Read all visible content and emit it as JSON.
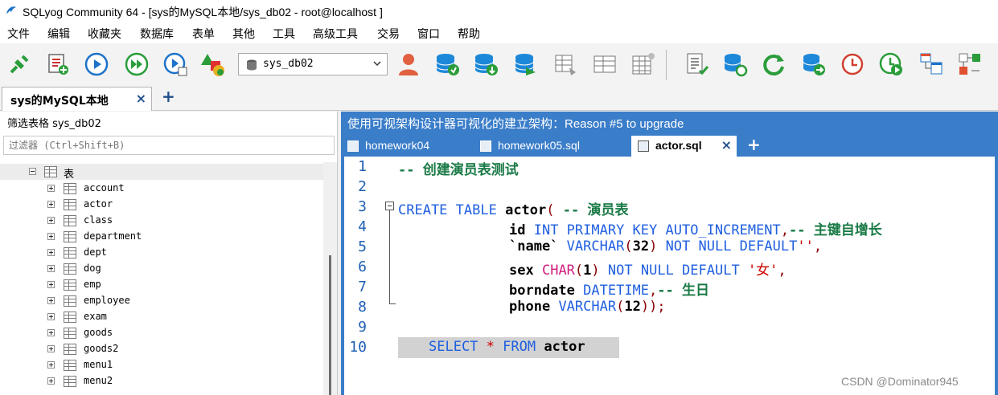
{
  "window": {
    "title": "SQLyog Community 64 - [sys的MySQL本地/sys_db02 - root@localhost ]"
  },
  "menu": [
    "文件",
    "编辑",
    "收藏夹",
    "数据库",
    "表单",
    "其他",
    "工具",
    "高级工具",
    "交易",
    "窗口",
    "帮助"
  ],
  "toolbar": {
    "database_select": "sys_db02"
  },
  "connection_tabs": [
    {
      "label": "sys的MySQL本地",
      "close": "×"
    }
  ],
  "add_tab": "+",
  "object_browser": {
    "filter_label": "筛选表格 sys_db02",
    "filter_placeholder": "过滤器 (Ctrl+Shift+B)",
    "root_label": "表",
    "tables": [
      "account",
      "actor",
      "class",
      "department",
      "dept",
      "dog",
      "emp",
      "employee",
      "exam",
      "goods",
      "goods2",
      "menu1",
      "menu2"
    ]
  },
  "editor_header": "使用可视架构设计器可视化的建立架构：Reason #5 to upgrade",
  "query_tabs": [
    {
      "label": "homework04",
      "active": false
    },
    {
      "label": "homework05.sql",
      "active": false
    },
    {
      "label": "actor.sql",
      "active": true,
      "close": "×"
    }
  ],
  "line_numbers": [
    "1",
    "2",
    "3",
    "4",
    "5",
    "6",
    "7",
    "8",
    "9",
    "10"
  ],
  "code": {
    "l1": "-- 创建演员表测试",
    "l3_kw": "CREATE TABLE",
    "l3_ident": "actor",
    "l3_paren": "(",
    "l3_cmt": "-- 演员表",
    "l4_ident": "id",
    "l4_kw": "INT PRIMARY KEY AUTO_INCREMENT",
    "l4_comma": ",",
    "l4_cmt": "-- 主键自增长",
    "l5_ident": "`name`",
    "l5_kw": "VARCHAR",
    "l5_p1": "(",
    "l5_num": "32",
    "l5_p2": ")",
    "l5_kw2": "NOT NULL DEFAULT",
    "l5_str": "''",
    "l5_comma": ",",
    "l6_ident": "sex",
    "l6_kw": "CHAR",
    "l6_p1": "(",
    "l6_num": "1",
    "l6_p2": ")",
    "l6_kw2": "NOT NULL DEFAULT",
    "l6_str": "'女'",
    "l6_comma": ",",
    "l7_ident": "borndate",
    "l7_kw": "DATETIME",
    "l7_comma": ",",
    "l7_cmt": "-- 生日",
    "l8_ident": "phone",
    "l8_kw": "VARCHAR",
    "l8_p1": "(",
    "l8_num": "12",
    "l8_p2": "));",
    "l10_kw": "SELECT",
    "l10_star": "*",
    "l10_kw2": "FROM",
    "l10_ident": "actor"
  },
  "watermark": "CSDN @Dominator945",
  "colors": {
    "accent": "#3a7dc9",
    "keyword": "#1f5fe0",
    "comment": "#1a7a46",
    "string": "#cc0000"
  },
  "icons": [
    "dolphin-logo-icon",
    "connect-icon",
    "new-query-icon",
    "execute-icon",
    "execute-all-icon",
    "execute-edit-icon",
    "schema-shapes-icon",
    "database-icon",
    "user-manager-icon",
    "create-db-icon",
    "import-db-icon",
    "backup-db-icon",
    "table-diff-icon",
    "table-grid-icon",
    "table-export-icon",
    "sql-script-icon",
    "sync-db-icon",
    "refresh-icon",
    "db-copy-icon",
    "schedule-icon",
    "run-schedule-icon",
    "schema-designer-icon",
    "query-builder-icon"
  ]
}
